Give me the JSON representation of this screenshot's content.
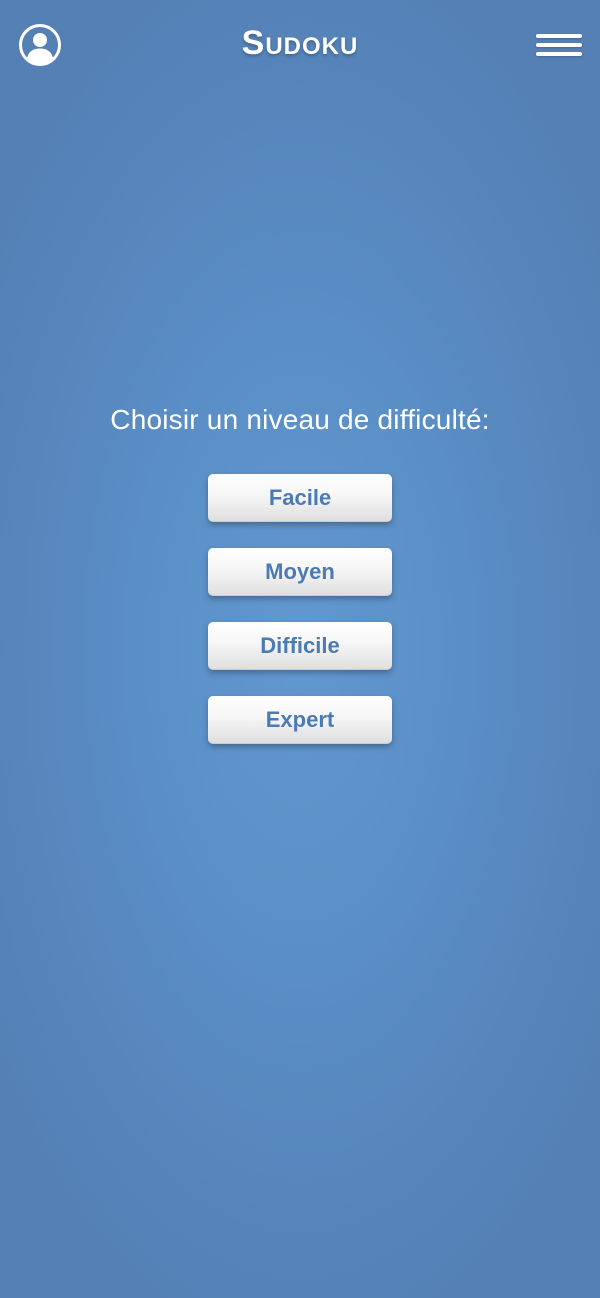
{
  "header": {
    "title": "Sudoku",
    "profile_icon": "user-circle-icon",
    "menu_icon": "hamburger-menu-icon"
  },
  "main": {
    "prompt": "Choisir un niveau de difficulté:",
    "levels": [
      {
        "label": "Facile"
      },
      {
        "label": "Moyen"
      },
      {
        "label": "Difficile"
      },
      {
        "label": "Expert"
      }
    ]
  },
  "colors": {
    "background": "#5a8ec6",
    "button_text": "#4a7bb4",
    "button_face": "#f6f6f6"
  }
}
